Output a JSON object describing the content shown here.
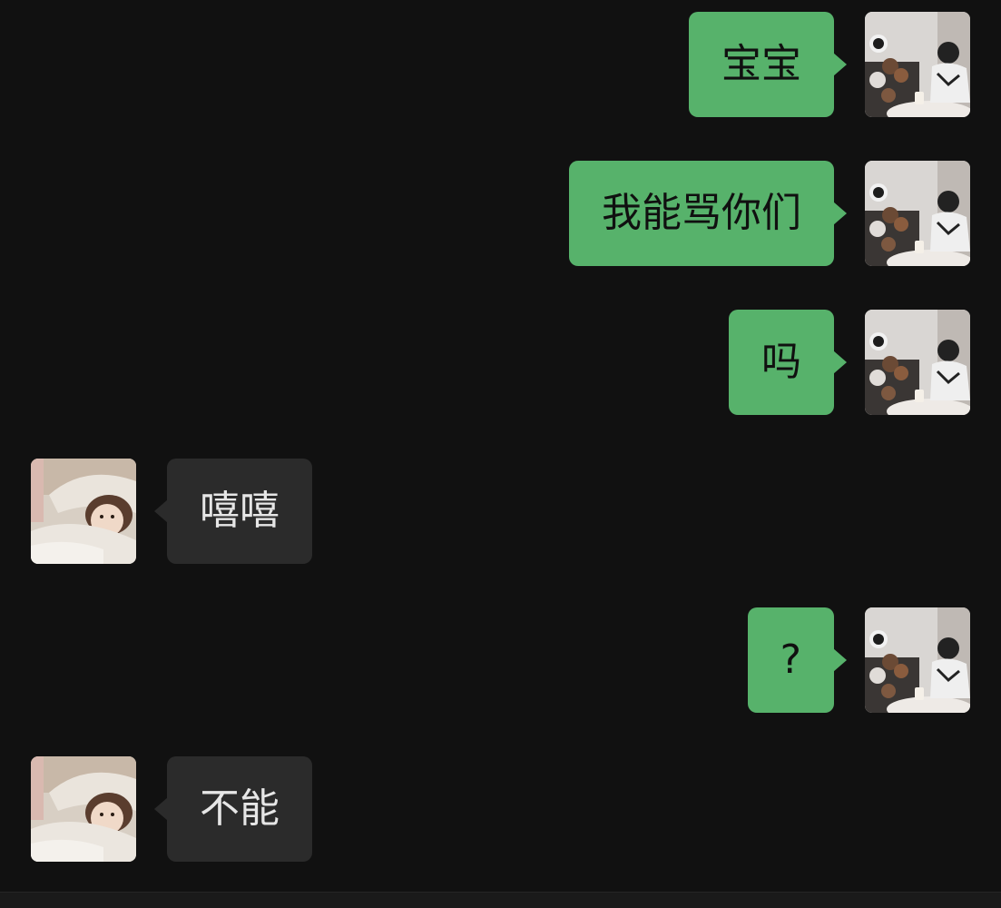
{
  "conversation": {
    "messages": [
      {
        "direction": "outgoing",
        "text": "宝宝"
      },
      {
        "direction": "outgoing",
        "text": "我能骂你们"
      },
      {
        "direction": "outgoing",
        "text": "吗"
      },
      {
        "direction": "incoming",
        "text": "嘻嘻"
      },
      {
        "direction": "outgoing",
        "text": "?"
      },
      {
        "direction": "incoming",
        "text": "不能"
      }
    ]
  },
  "colors": {
    "background": "#111111",
    "outgoing_bubble": "#57b26b",
    "incoming_bubble": "#2b2b2b"
  }
}
